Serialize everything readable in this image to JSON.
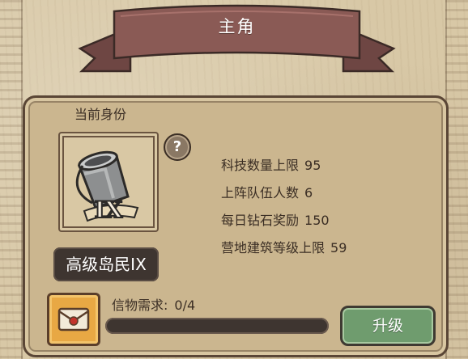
{
  "title": "主角",
  "section_label": "当前身份",
  "help_icon": "question-mark-icon",
  "stats": [
    {
      "label": "科技数量上限",
      "value": "95"
    },
    {
      "label": "上阵队伍人数",
      "value": "6"
    },
    {
      "label": "每日钻石奖励",
      "value": "150"
    },
    {
      "label": "营地建筑等级上限",
      "value": "59"
    }
  ],
  "rank_name": "高级岛民IX",
  "portrait_numeral": "IX",
  "portrait_icon": "bucket-icon",
  "token_icon": "envelope-icon",
  "requirement": {
    "label": "信物需求:",
    "value": "0/4",
    "fraction": 0
  },
  "upgrade_label": "升级",
  "colors": {
    "banner": "#8a5a55",
    "panel": "#cbb68f",
    "dark_box": "#3e3530",
    "upgrade_button": "#6f9c6e",
    "token_bg": "#e8a844"
  }
}
